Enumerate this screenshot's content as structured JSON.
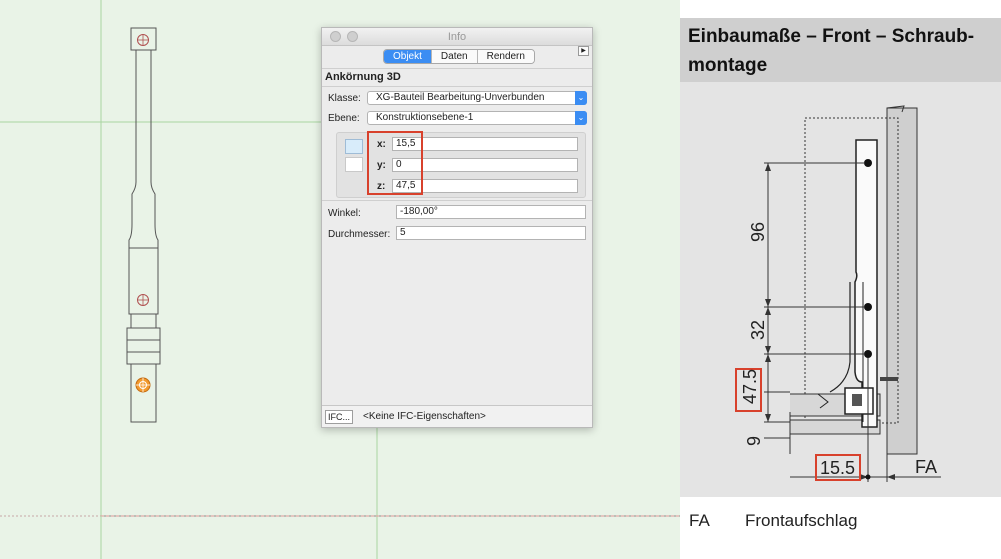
{
  "info_palette": {
    "title": "Info",
    "tabs": [
      {
        "label": "Objekt",
        "active": true
      },
      {
        "label": "Daten",
        "active": false
      },
      {
        "label": "Rendern",
        "active": false
      }
    ],
    "object_name": "Ankörnung 3D",
    "klasse": {
      "label": "Klasse:",
      "value": "XG-Bauteil Bearbeitung-Unverbunden"
    },
    "ebene": {
      "label": "Ebene:",
      "value": "Konstruktionsebene-1"
    },
    "coords": {
      "x": {
        "label": "x:",
        "value": "15,5"
      },
      "y": {
        "label": "y:",
        "value": "0"
      },
      "z": {
        "label": "z:",
        "value": "47,5"
      }
    },
    "winkel": {
      "label": "Winkel:",
      "value": "-180,00°"
    },
    "durchmesser": {
      "label": "Durchmesser:",
      "value": "5"
    },
    "footer": {
      "button": "IFC...",
      "text": "<Keine IFC-Eigenschaften>"
    }
  },
  "doc_panel": {
    "heading": "Einbaumaße – Front – Schraub-montage",
    "dimensions": {
      "d96": "96",
      "d32": "32",
      "d47": "47.5",
      "d9": "9",
      "d15": "15.5",
      "fa": "FA"
    },
    "legend": {
      "key": "FA",
      "value": "Frontaufschlag"
    }
  },
  "colors": {
    "canvas_bg": "#e9f3e7",
    "highlight_red": "#d8412c",
    "accent_blue": "#3b8df3",
    "hole_orange": "#f29a2e"
  }
}
